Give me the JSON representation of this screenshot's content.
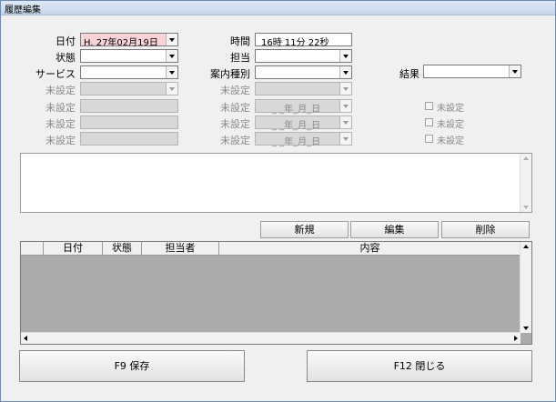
{
  "window": {
    "title": "履歴編集"
  },
  "form": {
    "date_label": "日付",
    "date_value": "H. 27年02月19日",
    "time_label": "時間",
    "time_value": "16時 11分 22秒",
    "status_label": "状態",
    "status_value": "",
    "staff_label": "担当",
    "staff_value": "",
    "service_label": "サービス",
    "service_value": "",
    "guide_label": "案内種別",
    "guide_value": "",
    "result_label": "結果",
    "result_value": "",
    "unset_label": "未設定",
    "date_placeholder": "_ _年_月_日"
  },
  "buttons": {
    "new": "新規",
    "edit": "編集",
    "delete": "削除",
    "save": "F9 保存",
    "close": "F12 閉じる"
  },
  "grid": {
    "columns": [
      "日付",
      "状態",
      "担当者",
      "内容"
    ]
  }
}
